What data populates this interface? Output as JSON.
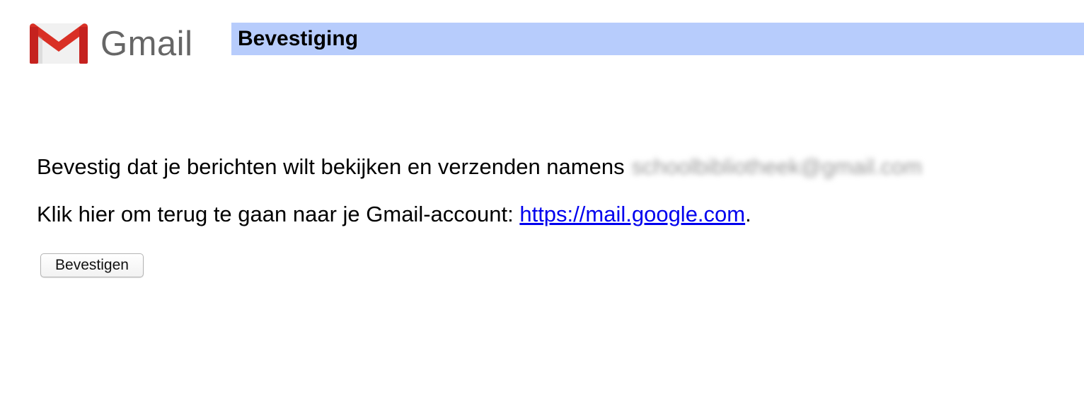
{
  "header": {
    "logo_text": "Gmail",
    "title": "Bevestiging"
  },
  "content": {
    "confirm_text": "Bevestig dat je berichten wilt bekijken en verzenden namens",
    "email_redacted": "schoolbibliotheek@gmail.com",
    "return_text": "Klik hier om terug te gaan naar je Gmail-account: ",
    "return_link": "https://mail.google.com",
    "return_suffix": "."
  },
  "actions": {
    "confirm_button": "Bevestigen"
  },
  "colors": {
    "title_bar": "#b7ccfc",
    "link": "#0000ee",
    "logo_red": "#d93025",
    "logo_text": "#666666"
  }
}
